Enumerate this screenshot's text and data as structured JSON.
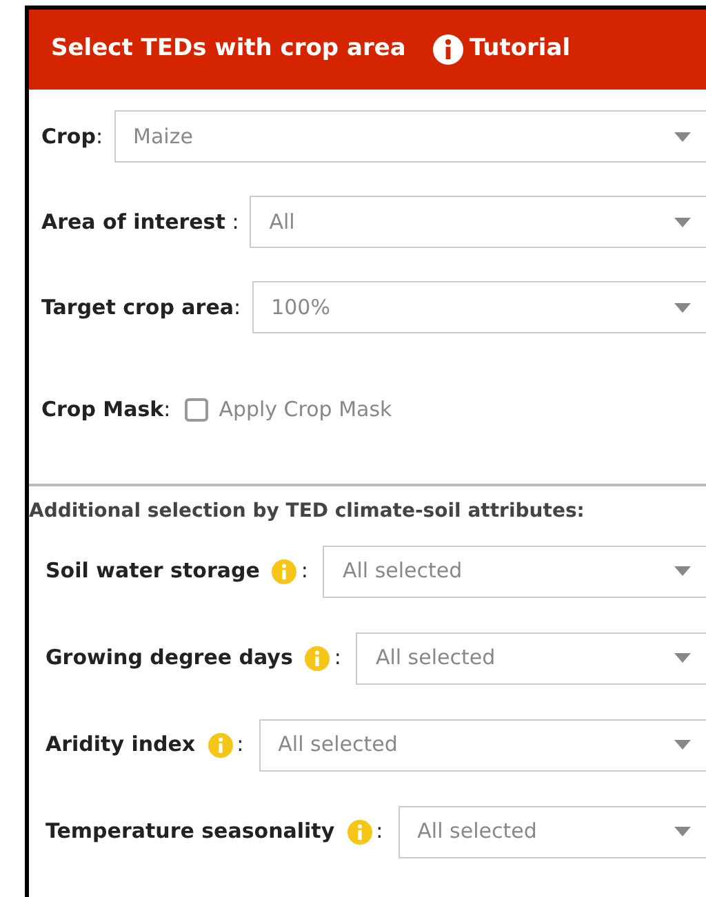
{
  "header": {
    "title": "Select TEDs with crop area",
    "tutorial": "Tutorial"
  },
  "fields": [
    {
      "label": "Crop",
      "separator": ":",
      "value": "Maize"
    },
    {
      "label": "Area of interest",
      "separator": " :",
      "value": "All"
    },
    {
      "label": "Target crop area",
      "separator": ":",
      "value": "100%"
    }
  ],
  "crop_mask": {
    "label": "Crop Mask",
    "separator": ":",
    "checkbox_label": "Apply Crop Mask",
    "checked": false
  },
  "additional": {
    "heading": "Additional selection by TED climate-soil attributes:",
    "attributes": [
      {
        "label": "Soil water storage",
        "separator": ":",
        "value": "All selected"
      },
      {
        "label": "Growing degree days",
        "separator": ":",
        "value": "All selected"
      },
      {
        "label": "Aridity index",
        "separator": ":",
        "value": "All selected"
      },
      {
        "label": "Temperature seasonality",
        "separator": ":",
        "value": "All selected"
      }
    ]
  }
}
